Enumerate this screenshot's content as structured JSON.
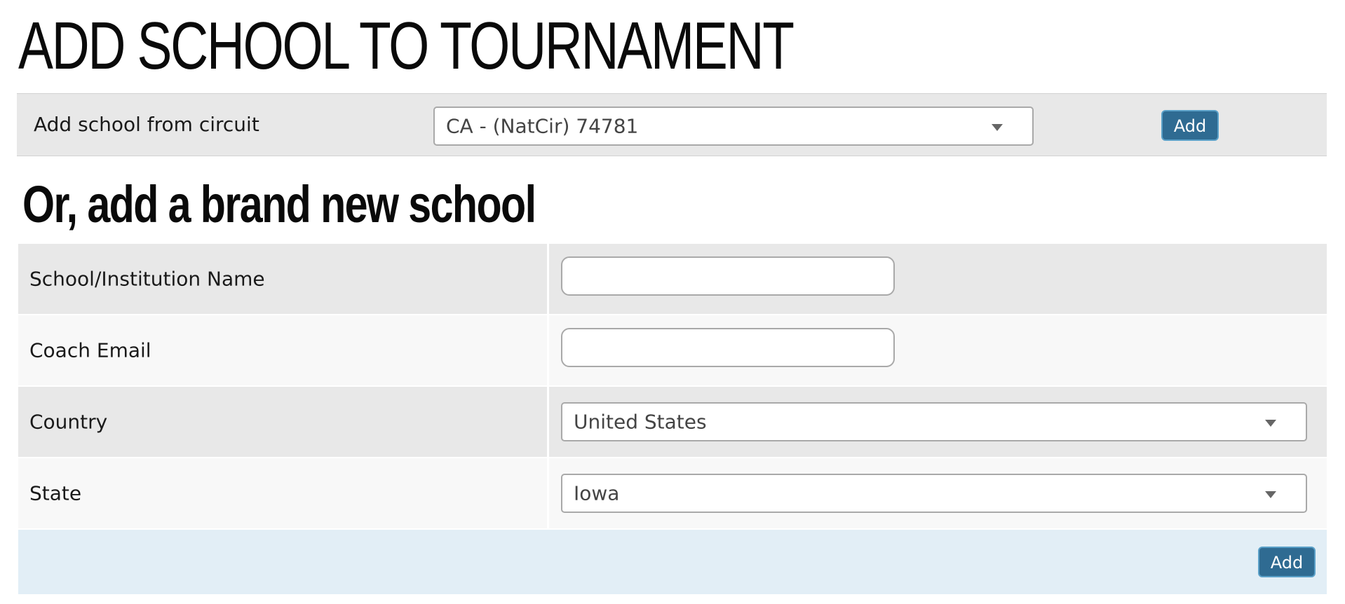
{
  "page": {
    "title": "ADD SCHOOL TO TOURNAMENT"
  },
  "circuit": {
    "label": "Add school from circuit",
    "selected": "CA - (NatCir) 74781",
    "add_label": "Add"
  },
  "new_school": {
    "heading": "Or, add a brand new school",
    "fields": {
      "name": {
        "label": "School/Institution Name",
        "value": "",
        "placeholder": ""
      },
      "email": {
        "label": "Coach Email",
        "value": "",
        "placeholder": ""
      },
      "country": {
        "label": "Country",
        "selected": "United States"
      },
      "state": {
        "label": "State",
        "selected": "Iowa"
      }
    },
    "submit_label": "Add"
  },
  "colors": {
    "button_bg": "#2f6b92",
    "row_odd": "#e8e8e8",
    "row_even": "#f8f8f8",
    "footer_bg": "#e2eef6"
  },
  "icons": {
    "select_caret": "chevron-down-icon"
  }
}
